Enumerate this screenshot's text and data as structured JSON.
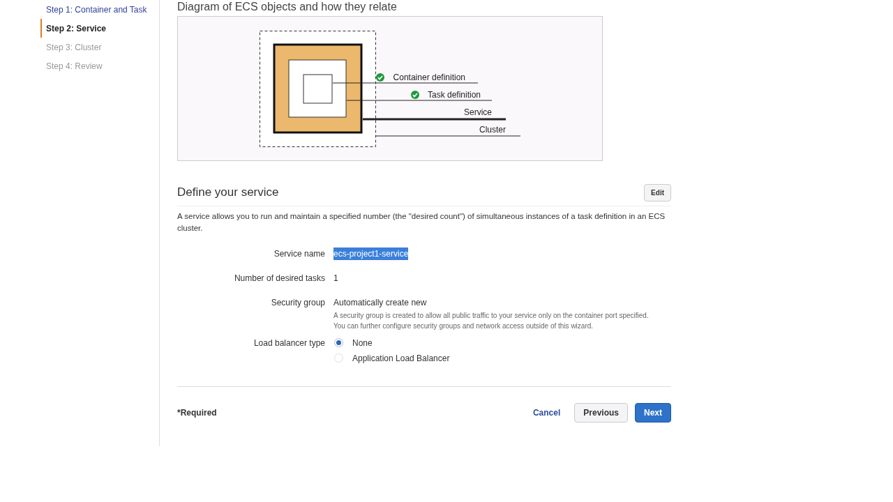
{
  "steps": [
    {
      "label": "Step 1: Container and Task",
      "selected": false,
      "disabled": false
    },
    {
      "label": "Step 2: Service",
      "selected": true,
      "disabled": false
    },
    {
      "label": "Step 3: Cluster",
      "selected": false,
      "disabled": true
    },
    {
      "label": "Step 4: Review",
      "selected": false,
      "disabled": true
    }
  ],
  "diagram": {
    "title": "Diagram of ECS objects and how they relate",
    "labels": [
      {
        "text": "Container definition",
        "checked": true
      },
      {
        "text": "Task definition",
        "checked": true
      },
      {
        "text": "Service",
        "checked": false
      },
      {
        "text": "Cluster",
        "checked": false
      }
    ]
  },
  "section": {
    "title": "Define your service",
    "edit_button": "Edit",
    "description": "A service allows you to run and maintain a specified number (the \"desired count\") of simultaneous instances of a task definition in an ECS cluster.",
    "fields": [
      {
        "label": "Service name",
        "value": "ecs-project1-service",
        "highlighted": true
      },
      {
        "label": "Number of desired tasks",
        "value": "1",
        "highlighted": false
      },
      {
        "label": "Security group",
        "value": "Automatically create new",
        "highlighted": false,
        "help": "A security group is created to allow all public traffic to your service only on the container port specified. You can further configure security groups and network access outside of this wizard."
      }
    ],
    "load_balancer": {
      "label": "Load balancer type",
      "options": [
        {
          "label": "None",
          "selected": true
        },
        {
          "label": "Application Load Balancer",
          "selected": false
        }
      ]
    }
  },
  "footer": {
    "required_note": "*Required",
    "cancel": "Cancel",
    "previous": "Previous",
    "next": "Next"
  }
}
